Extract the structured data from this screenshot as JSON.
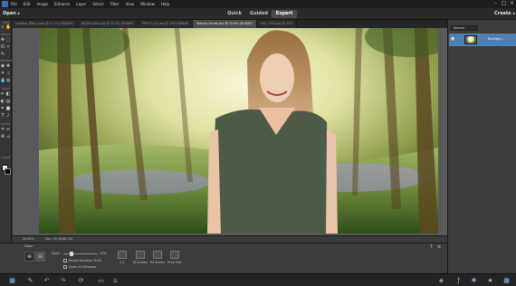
{
  "menubar": {
    "items": [
      "File",
      "Edit",
      "Image",
      "Enhance",
      "Layer",
      "Select",
      "Filter",
      "View",
      "Window",
      "Help"
    ]
  },
  "modebar": {
    "open_label": "Open",
    "tabs": [
      {
        "label": "Quick"
      },
      {
        "label": "Guided"
      },
      {
        "label": "Expert"
      }
    ],
    "create_label": "Create"
  },
  "doc_tabs": [
    {
      "label": "Untitled_PDM-1.psd @ 27.2% (RGB/8*)"
    },
    {
      "label": "WOOD-0001.jpg @ 21.3% (RGB/8*)"
    },
    {
      "label": "PHOTO_01.psd @ 25% (RGB/8)"
    },
    {
      "label": "Woman-Forest.psd @ 20.8% (RGB/8*)",
      "active": true
    },
    {
      "label": "IMG_7705.jpg @ 25%"
    }
  ],
  "toolbox": {
    "sections": [
      "VIEW",
      "SELECT",
      "ENHANCE",
      "DRAW",
      "MODIFY",
      "COLOR"
    ]
  },
  "status": {
    "zoom": "20.83%",
    "doc_info": "Doc: 59.3M/62.3M"
  },
  "layers": {
    "blend_mode": "Normal",
    "layer_name": "Backgro..."
  },
  "options": {
    "tool_title": "Zoom",
    "zoom_label": "Zoom",
    "zoom_value": "21%",
    "zoom_fraction": 0.21,
    "checkbox_1": "Resize Windows To Fit",
    "checkbox_2": "Zoom All Windows",
    "view_buttons": [
      "1:1",
      "Fit Screen",
      "Fill Screen",
      "Print Size"
    ]
  },
  "colors": {
    "accent": "#4c7fb3",
    "foreground": "#f0efe4",
    "background": "#0a0a0a"
  }
}
